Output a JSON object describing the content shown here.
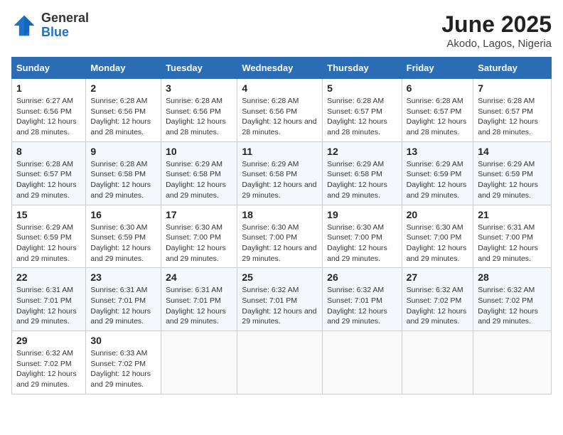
{
  "logo": {
    "general": "General",
    "blue": "Blue"
  },
  "header": {
    "month": "June 2025",
    "location": "Akodo, Lagos, Nigeria"
  },
  "weekdays": [
    "Sunday",
    "Monday",
    "Tuesday",
    "Wednesday",
    "Thursday",
    "Friday",
    "Saturday"
  ],
  "weeks": [
    [
      {
        "day": "1",
        "sunrise": "Sunrise: 6:27 AM",
        "sunset": "Sunset: 6:56 PM",
        "daylight": "Daylight: 12 hours and 28 minutes."
      },
      {
        "day": "2",
        "sunrise": "Sunrise: 6:28 AM",
        "sunset": "Sunset: 6:56 PM",
        "daylight": "Daylight: 12 hours and 28 minutes."
      },
      {
        "day": "3",
        "sunrise": "Sunrise: 6:28 AM",
        "sunset": "Sunset: 6:56 PM",
        "daylight": "Daylight: 12 hours and 28 minutes."
      },
      {
        "day": "4",
        "sunrise": "Sunrise: 6:28 AM",
        "sunset": "Sunset: 6:56 PM",
        "daylight": "Daylight: 12 hours and 28 minutes."
      },
      {
        "day": "5",
        "sunrise": "Sunrise: 6:28 AM",
        "sunset": "Sunset: 6:57 PM",
        "daylight": "Daylight: 12 hours and 28 minutes."
      },
      {
        "day": "6",
        "sunrise": "Sunrise: 6:28 AM",
        "sunset": "Sunset: 6:57 PM",
        "daylight": "Daylight: 12 hours and 28 minutes."
      },
      {
        "day": "7",
        "sunrise": "Sunrise: 6:28 AM",
        "sunset": "Sunset: 6:57 PM",
        "daylight": "Daylight: 12 hours and 28 minutes."
      }
    ],
    [
      {
        "day": "8",
        "sunrise": "Sunrise: 6:28 AM",
        "sunset": "Sunset: 6:57 PM",
        "daylight": "Daylight: 12 hours and 29 minutes."
      },
      {
        "day": "9",
        "sunrise": "Sunrise: 6:28 AM",
        "sunset": "Sunset: 6:58 PM",
        "daylight": "Daylight: 12 hours and 29 minutes."
      },
      {
        "day": "10",
        "sunrise": "Sunrise: 6:29 AM",
        "sunset": "Sunset: 6:58 PM",
        "daylight": "Daylight: 12 hours and 29 minutes."
      },
      {
        "day": "11",
        "sunrise": "Sunrise: 6:29 AM",
        "sunset": "Sunset: 6:58 PM",
        "daylight": "Daylight: 12 hours and 29 minutes."
      },
      {
        "day": "12",
        "sunrise": "Sunrise: 6:29 AM",
        "sunset": "Sunset: 6:58 PM",
        "daylight": "Daylight: 12 hours and 29 minutes."
      },
      {
        "day": "13",
        "sunrise": "Sunrise: 6:29 AM",
        "sunset": "Sunset: 6:59 PM",
        "daylight": "Daylight: 12 hours and 29 minutes."
      },
      {
        "day": "14",
        "sunrise": "Sunrise: 6:29 AM",
        "sunset": "Sunset: 6:59 PM",
        "daylight": "Daylight: 12 hours and 29 minutes."
      }
    ],
    [
      {
        "day": "15",
        "sunrise": "Sunrise: 6:29 AM",
        "sunset": "Sunset: 6:59 PM",
        "daylight": "Daylight: 12 hours and 29 minutes."
      },
      {
        "day": "16",
        "sunrise": "Sunrise: 6:30 AM",
        "sunset": "Sunset: 6:59 PM",
        "daylight": "Daylight: 12 hours and 29 minutes."
      },
      {
        "day": "17",
        "sunrise": "Sunrise: 6:30 AM",
        "sunset": "Sunset: 7:00 PM",
        "daylight": "Daylight: 12 hours and 29 minutes."
      },
      {
        "day": "18",
        "sunrise": "Sunrise: 6:30 AM",
        "sunset": "Sunset: 7:00 PM",
        "daylight": "Daylight: 12 hours and 29 minutes."
      },
      {
        "day": "19",
        "sunrise": "Sunrise: 6:30 AM",
        "sunset": "Sunset: 7:00 PM",
        "daylight": "Daylight: 12 hours and 29 minutes."
      },
      {
        "day": "20",
        "sunrise": "Sunrise: 6:30 AM",
        "sunset": "Sunset: 7:00 PM",
        "daylight": "Daylight: 12 hours and 29 minutes."
      },
      {
        "day": "21",
        "sunrise": "Sunrise: 6:31 AM",
        "sunset": "Sunset: 7:00 PM",
        "daylight": "Daylight: 12 hours and 29 minutes."
      }
    ],
    [
      {
        "day": "22",
        "sunrise": "Sunrise: 6:31 AM",
        "sunset": "Sunset: 7:01 PM",
        "daylight": "Daylight: 12 hours and 29 minutes."
      },
      {
        "day": "23",
        "sunrise": "Sunrise: 6:31 AM",
        "sunset": "Sunset: 7:01 PM",
        "daylight": "Daylight: 12 hours and 29 minutes."
      },
      {
        "day": "24",
        "sunrise": "Sunrise: 6:31 AM",
        "sunset": "Sunset: 7:01 PM",
        "daylight": "Daylight: 12 hours and 29 minutes."
      },
      {
        "day": "25",
        "sunrise": "Sunrise: 6:32 AM",
        "sunset": "Sunset: 7:01 PM",
        "daylight": "Daylight: 12 hours and 29 minutes."
      },
      {
        "day": "26",
        "sunrise": "Sunrise: 6:32 AM",
        "sunset": "Sunset: 7:01 PM",
        "daylight": "Daylight: 12 hours and 29 minutes."
      },
      {
        "day": "27",
        "sunrise": "Sunrise: 6:32 AM",
        "sunset": "Sunset: 7:02 PM",
        "daylight": "Daylight: 12 hours and 29 minutes."
      },
      {
        "day": "28",
        "sunrise": "Sunrise: 6:32 AM",
        "sunset": "Sunset: 7:02 PM",
        "daylight": "Daylight: 12 hours and 29 minutes."
      }
    ],
    [
      {
        "day": "29",
        "sunrise": "Sunrise: 6:32 AM",
        "sunset": "Sunset: 7:02 PM",
        "daylight": "Daylight: 12 hours and 29 minutes."
      },
      {
        "day": "30",
        "sunrise": "Sunrise: 6:33 AM",
        "sunset": "Sunset: 7:02 PM",
        "daylight": "Daylight: 12 hours and 29 minutes."
      },
      null,
      null,
      null,
      null,
      null
    ]
  ]
}
